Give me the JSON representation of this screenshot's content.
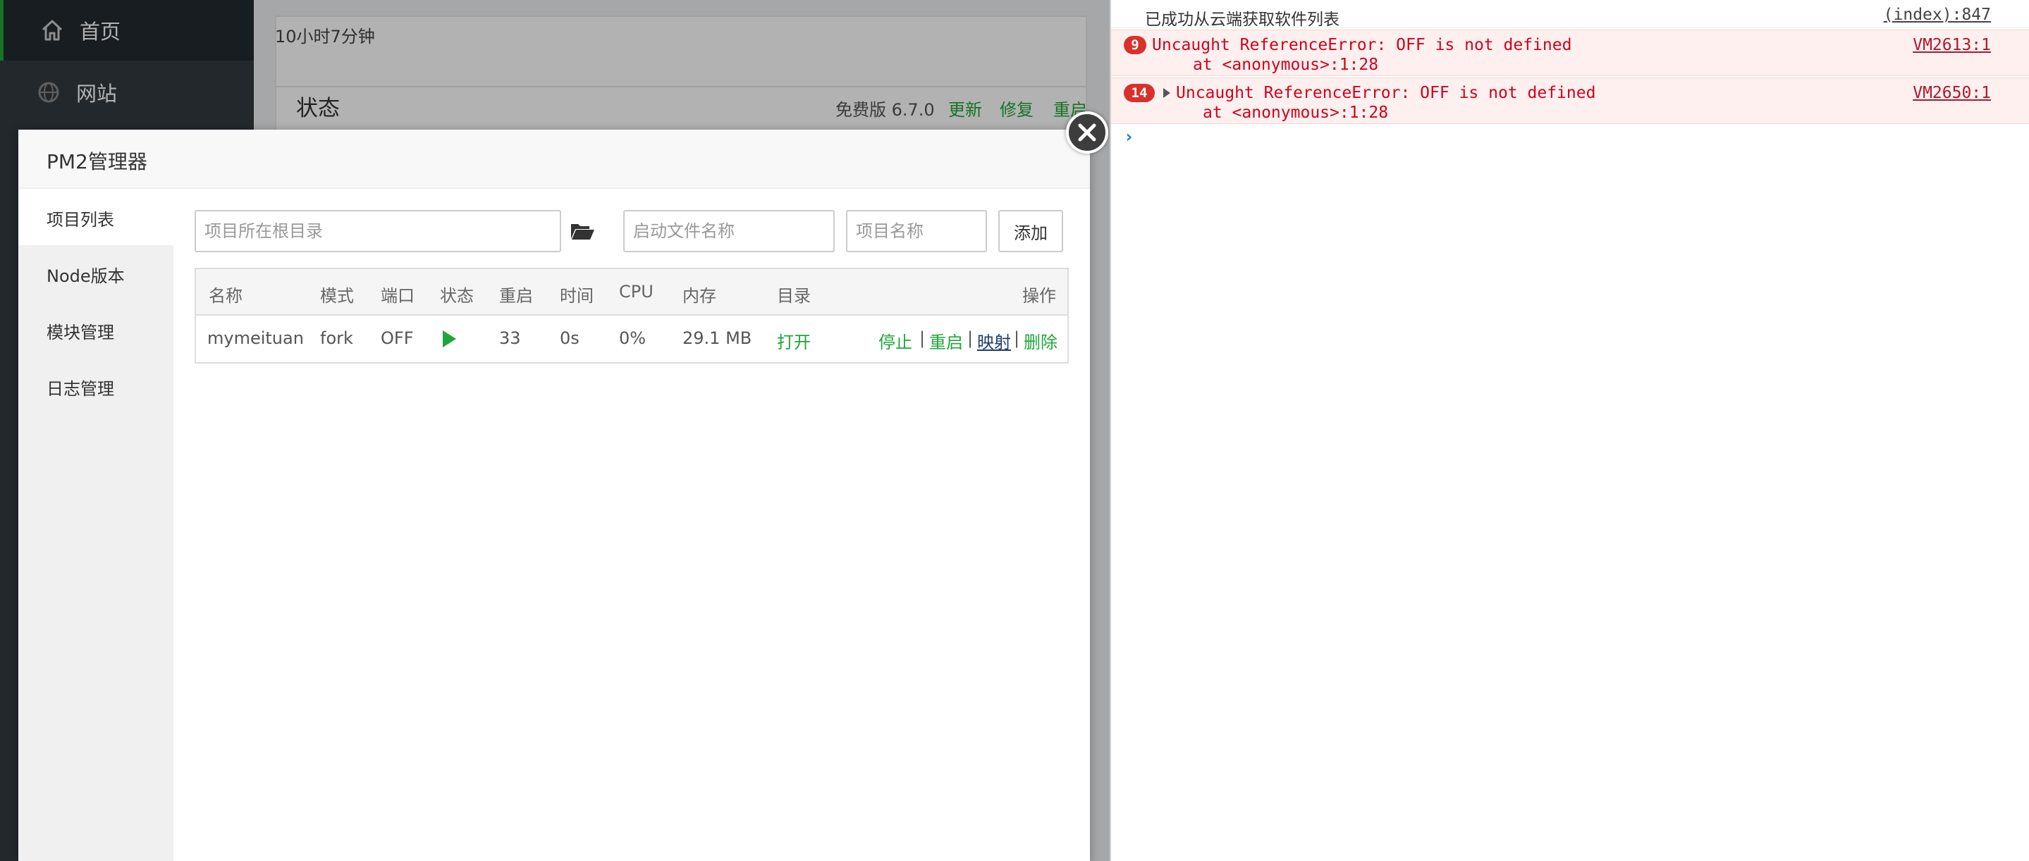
{
  "sidebar": {
    "items": [
      {
        "label": "首页",
        "icon": "home-icon"
      },
      {
        "label": "网站",
        "icon": "globe-icon"
      }
    ]
  },
  "status_panel": {
    "uptime": "10小时7分钟",
    "title": "状态",
    "version": "免费版 6.7.0",
    "links": [
      "更新",
      "修复",
      "重启"
    ]
  },
  "modal": {
    "title": "PM2管理器",
    "menu": [
      "项目列表",
      "Node版本",
      "模块管理",
      "日志管理"
    ],
    "inputs": {
      "root_placeholder": "项目所在根目录",
      "start_placeholder": "启动文件名称",
      "name_placeholder": "项目名称"
    },
    "add_label": "添加",
    "table": {
      "headers": [
        "名称",
        "模式",
        "端口",
        "状态",
        "重启",
        "时间",
        "CPU",
        "内存",
        "目录",
        "操作"
      ],
      "rows": [
        {
          "name": "mymeituan",
          "mode": "fork",
          "port": "OFF",
          "status": "running",
          "restarts": "33",
          "time": "0s",
          "cpu": "0%",
          "memory": "29.1 MB",
          "dir": "打开",
          "ops": [
            "停止",
            "重启",
            "映射",
            "删除"
          ]
        }
      ]
    }
  },
  "console": {
    "logs": [
      {
        "type": "info",
        "message": "已成功从云端获取软件列表",
        "source": "(index):847"
      },
      {
        "type": "error",
        "count": "9",
        "message": "Uncaught ReferenceError: OFF is not defined",
        "detail": "at <anonymous>:1:28",
        "source": "VM2613:1"
      },
      {
        "type": "error",
        "count": "14",
        "message": "Uncaught ReferenceError: OFF is not defined",
        "detail": "at <anonymous>:1:28",
        "source": "VM2650:1"
      }
    ],
    "prompt": "›"
  },
  "colors": {
    "accent": "#20a53a",
    "sidebar_bg": "#333a40",
    "error": "#d0021b",
    "badge": "#d9302b"
  }
}
